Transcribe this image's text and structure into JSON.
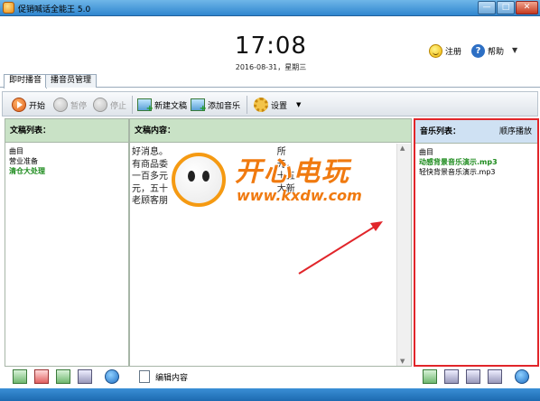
{
  "window": {
    "title": "促销喊话全能王 5.0",
    "min": "—",
    "max": "□",
    "close": "✕"
  },
  "header": {
    "time": "17:08",
    "date": "2016-08-31，星期三",
    "register": "注册",
    "help": "帮助",
    "menu_arrow": "▼"
  },
  "tabs": [
    {
      "label": "即时播音"
    },
    {
      "label": "播音员管理"
    }
  ],
  "toolbar": {
    "start": "开始",
    "pause": "暂停",
    "stop": "停止",
    "new_doc": "新建文稿",
    "add_music": "添加音乐",
    "settings": "设置",
    "settings_arrow": "▼"
  },
  "doc_list": {
    "title": "文稿列表：",
    "header": "曲目",
    "items": [
      "营业准备",
      "清仓大处理"
    ]
  },
  "doc_content": {
    "title": "文稿内容：",
    "lines": [
      "好消息。                                      所",
      "有商品委                                      元，",
      "一百多元                                      十五",
      "元，五十                                      大新",
      "老顾客朋"
    ]
  },
  "music_list": {
    "title": "音乐列表：",
    "order": "顺序播放",
    "header": "曲目",
    "items": [
      "动感背景音乐演示.mp3",
      "轻快背景音乐演示.mp3"
    ]
  },
  "bottom": {
    "edit_label": "编辑内容"
  },
  "watermark": {
    "title": "开心电玩",
    "url": "www.kxdw.com"
  },
  "colors": {
    "highlight_border": "#e1252a",
    "panel_head_green": "#c9e2c6",
    "panel_head_blue": "#cfe1f3",
    "accent": "#f07a10"
  }
}
